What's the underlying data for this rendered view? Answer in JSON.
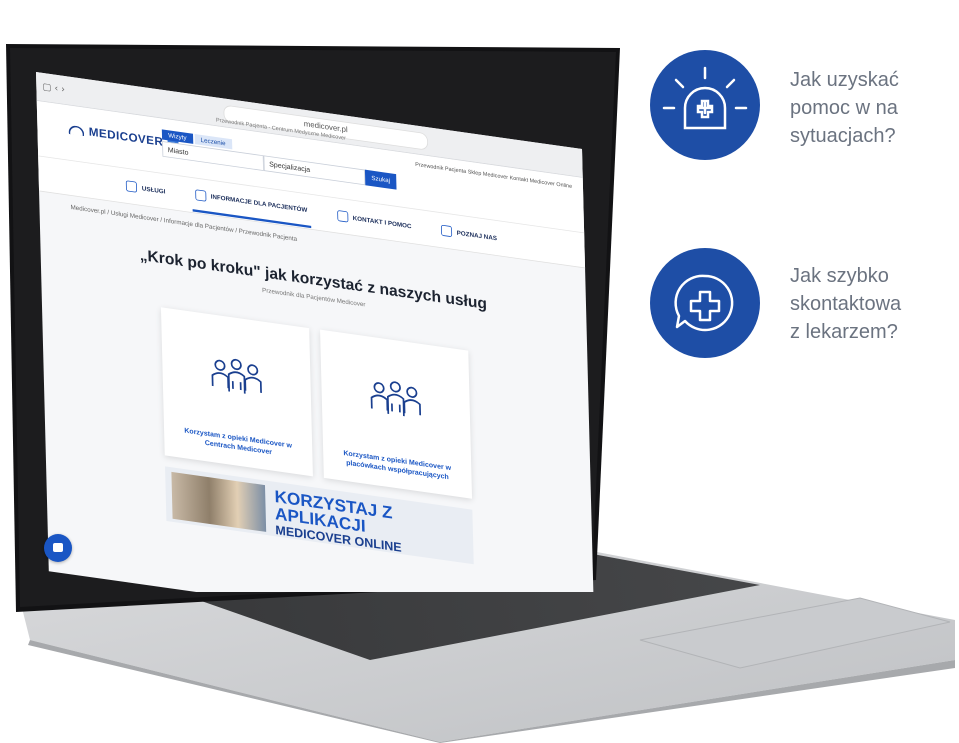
{
  "browser": {
    "url": "medicover.pl",
    "tab_title": "Przewodnik Pacjenta - Centrum Medyczne Medicover"
  },
  "site": {
    "logo_text": "MEDICOVER",
    "search_tabs": [
      "Wizyty",
      "Leczenie"
    ],
    "search_city": "Miasto",
    "search_specialty": "Specjalizacja",
    "search_button": "Szukaj",
    "top_links": "Przewodnik Pacjenta   Sklep Medicover   Kontakt   Medicover Online",
    "nav": [
      {
        "label": "USŁUGI"
      },
      {
        "label": "INFORMACJE DLA PACJENTÓW"
      },
      {
        "label": "KONTAKT I POMOC"
      },
      {
        "label": "POZNAJ NAS"
      }
    ],
    "breadcrumb": "Medicover.pl / Usługi Medicover / Informacje dla Pacjentów / Przewodnik Pacjenta",
    "hero_title": "„Krok po kroku\" jak korzystać z naszych usług",
    "hero_subtitle": "Przewodnik dla Pacjentów Medicover",
    "cards": [
      {
        "label": "Korzystam z opieki Medicover w Centrach Medicover"
      },
      {
        "label": "Korzystam z opieki Medicover w placówkach współpracujących"
      }
    ],
    "banner_line1": "KORZYSTAJ Z APLIKACJI",
    "banner_line2": "MEDICOVER ONLINE"
  },
  "info": [
    {
      "icon": "alarm-cross-icon",
      "text": [
        "Jak uzyskać",
        "pomoc w na",
        "sytuacjach?"
      ]
    },
    {
      "icon": "chat-cross-icon",
      "text": [
        "Jak szybko",
        "skontaktowa",
        "z lekarzem?"
      ]
    }
  ],
  "colors": {
    "accent": "#1e4ea6",
    "text_gray": "#6b7380"
  }
}
